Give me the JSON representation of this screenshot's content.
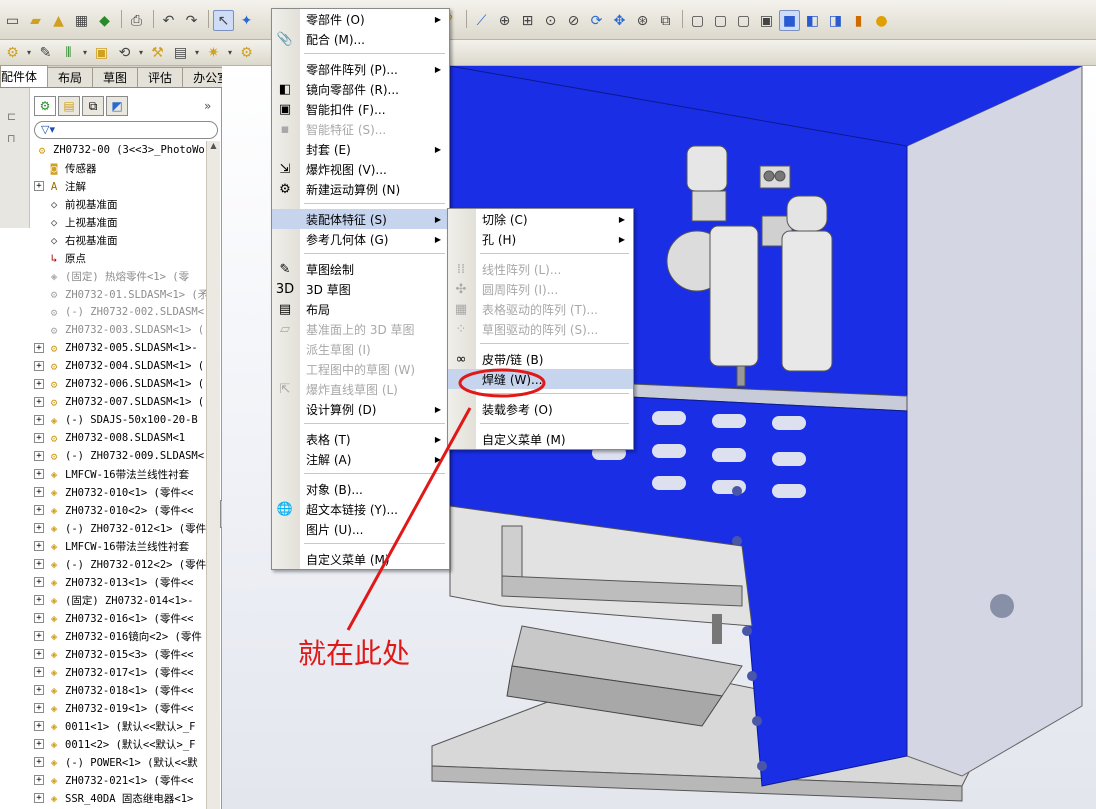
{
  "toolbar": {
    "icons_row1": [
      "new-icon",
      "open-icon",
      "save-icon",
      "print-icon",
      "undo-icon",
      "redo-icon",
      "select-arrow-icon",
      "rebuild-icon",
      "options-icon",
      "help-icon"
    ],
    "icons_view": [
      "zoom-fit-icon",
      "zoom-area-icon",
      "zoom-in-out-icon",
      "zoom-select-icon",
      "rotate-icon",
      "pan-icon",
      "view-orient-icon",
      "display-style-icon",
      "section-icon",
      "wireframe-icon",
      "hidden-line-icon",
      "shaded-icon",
      "shaded-edges-icon",
      "appearance-icon",
      "scene-icon"
    ]
  },
  "tabs": [
    {
      "label": "配件体"
    },
    {
      "label": "布局"
    },
    {
      "label": "草图"
    },
    {
      "label": "评估"
    },
    {
      "label": "办公室产品"
    }
  ],
  "tree": {
    "filter_text": "▽▾",
    "root": "ZH0732-00  (3<<3>_PhotoWo",
    "items": [
      {
        "label": "传感器",
        "expand": "",
        "grey": false,
        "icon": "sensor"
      },
      {
        "label": "注解",
        "expand": "+",
        "grey": false,
        "icon": "annotation"
      },
      {
        "label": "前视基准面",
        "expand": "",
        "grey": false,
        "icon": "plane"
      },
      {
        "label": "上视基准面",
        "expand": "",
        "grey": false,
        "icon": "plane"
      },
      {
        "label": "右视基准面",
        "expand": "",
        "grey": false,
        "icon": "plane"
      },
      {
        "label": "原点",
        "expand": "",
        "grey": false,
        "icon": "origin"
      },
      {
        "label": "(固定) 热熔零件<1> (零",
        "expand": "",
        "grey": true,
        "icon": "part"
      },
      {
        "label": "ZH0732-01.SLDASM<1> (矛",
        "expand": "",
        "grey": true,
        "icon": "asm"
      },
      {
        "label": "(-) ZH0732-002.SLDASM<",
        "expand": "",
        "grey": true,
        "icon": "asm"
      },
      {
        "label": "ZH0732-003.SLDASM<1> (",
        "expand": "",
        "grey": true,
        "icon": "asm"
      },
      {
        "label": "ZH0732-005.SLDASM<1>-",
        "expand": "+",
        "grey": false,
        "icon": "asm"
      },
      {
        "label": "ZH0732-004.SLDASM<1> (",
        "expand": "+",
        "grey": false,
        "icon": "asm"
      },
      {
        "label": "ZH0732-006.SLDASM<1> (",
        "expand": "+",
        "grey": false,
        "icon": "asm"
      },
      {
        "label": "ZH0732-007.SLDASM<1> (",
        "expand": "+",
        "grey": false,
        "icon": "asm"
      },
      {
        "label": "(-) SDAJS-50x100-20-B",
        "expand": "+",
        "grey": false,
        "icon": "part"
      },
      {
        "label": "ZH0732-008.SLDASM<1",
        "expand": "+",
        "grey": false,
        "icon": "asm"
      },
      {
        "label": "(-) ZH0732-009.SLDASM<",
        "expand": "+",
        "grey": false,
        "icon": "asm"
      },
      {
        "label": "LMFCW-16带法兰线性衬套",
        "expand": "+",
        "grey": false,
        "icon": "part"
      },
      {
        "label": "ZH0732-010<1> (零件<<",
        "expand": "+",
        "grey": false,
        "icon": "part"
      },
      {
        "label": "ZH0732-010<2> (零件<<",
        "expand": "+",
        "grey": false,
        "icon": "part"
      },
      {
        "label": "(-) ZH0732-012<1> (零件",
        "expand": "+",
        "grey": false,
        "icon": "part"
      },
      {
        "label": "LMFCW-16带法兰线性衬套",
        "expand": "+",
        "grey": false,
        "icon": "part"
      },
      {
        "label": "(-) ZH0732-012<2> (零件",
        "expand": "+",
        "grey": false,
        "icon": "part"
      },
      {
        "label": "ZH0732-013<1> (零件<<",
        "expand": "+",
        "grey": false,
        "icon": "part"
      },
      {
        "label": "(固定) ZH0732-014<1>-",
        "expand": "+",
        "grey": false,
        "icon": "part"
      },
      {
        "label": "ZH0732-016<1> (零件<<",
        "expand": "+",
        "grey": false,
        "icon": "part"
      },
      {
        "label": "ZH0732-016镜向<2> (零件",
        "expand": "+",
        "grey": false,
        "icon": "part"
      },
      {
        "label": "ZH0732-015<3> (零件<<",
        "expand": "+",
        "grey": false,
        "icon": "part"
      },
      {
        "label": "ZH0732-017<1> (零件<<",
        "expand": "+",
        "grey": false,
        "icon": "part"
      },
      {
        "label": "ZH0732-018<1> (零件<<",
        "expand": "+",
        "grey": false,
        "icon": "part"
      },
      {
        "label": "ZH0732-019<1> (零件<<",
        "expand": "+",
        "grey": false,
        "icon": "part"
      },
      {
        "label": "0011<1> (默认<<默认>_F",
        "expand": "+",
        "grey": false,
        "icon": "part"
      },
      {
        "label": "0011<2> (默认<<默认>_F",
        "expand": "+",
        "grey": false,
        "icon": "part"
      },
      {
        "label": "(-) POWER<1> (默认<<默",
        "expand": "+",
        "grey": false,
        "icon": "part"
      },
      {
        "label": "ZH0732-021<1> (零件<<",
        "expand": "+",
        "grey": false,
        "icon": "part"
      },
      {
        "label": "SSR_40DA 固态继电器<1>",
        "expand": "+",
        "grey": false,
        "icon": "part"
      }
    ]
  },
  "insert_menu": {
    "items": [
      {
        "label": "零部件 (O)",
        "arrow": true,
        "disabled": false,
        "icon": ""
      },
      {
        "label": "配合 (M)...",
        "arrow": false,
        "disabled": false,
        "icon": "📎"
      },
      {
        "sep": true
      },
      {
        "label": "零部件阵列 (P)...",
        "arrow": true,
        "disabled": false,
        "icon": ""
      },
      {
        "label": "镜向零部件 (R)...",
        "arrow": false,
        "disabled": false,
        "icon": "◧"
      },
      {
        "label": "智能扣件 (F)...",
        "arrow": false,
        "disabled": false,
        "icon": "▣"
      },
      {
        "label": "智能特征 (S)...",
        "arrow": false,
        "disabled": true,
        "icon": "▪"
      },
      {
        "label": "封套 (E)",
        "arrow": true,
        "disabled": false,
        "icon": ""
      },
      {
        "label": "爆炸视图 (V)...",
        "arrow": false,
        "disabled": false,
        "icon": "⇲"
      },
      {
        "label": "新建运动算例 (N)",
        "arrow": false,
        "disabled": false,
        "icon": "⚙"
      },
      {
        "sep": true
      },
      {
        "label": "装配体特征 (S)",
        "arrow": true,
        "disabled": false,
        "icon": "",
        "highlight": true
      },
      {
        "label": "参考几何体 (G)",
        "arrow": true,
        "disabled": false,
        "icon": ""
      },
      {
        "sep": true
      },
      {
        "label": "草图绘制",
        "arrow": false,
        "disabled": false,
        "icon": "✎"
      },
      {
        "label": "3D 草图",
        "arrow": false,
        "disabled": false,
        "icon": "3D"
      },
      {
        "label": "布局",
        "arrow": false,
        "disabled": false,
        "icon": "▤"
      },
      {
        "label": "基准面上的 3D 草图",
        "arrow": false,
        "disabled": true,
        "icon": "▱"
      },
      {
        "label": "派生草图 (I)",
        "arrow": false,
        "disabled": true,
        "icon": ""
      },
      {
        "label": "工程图中的草图 (W)",
        "arrow": false,
        "disabled": true,
        "icon": ""
      },
      {
        "label": "爆炸直线草图 (L)",
        "arrow": false,
        "disabled": true,
        "icon": "⇱"
      },
      {
        "label": "设计算例 (D)",
        "arrow": true,
        "disabled": false,
        "icon": ""
      },
      {
        "sep": true
      },
      {
        "label": "表格 (T)",
        "arrow": true,
        "disabled": false,
        "icon": ""
      },
      {
        "label": "注解 (A)",
        "arrow": true,
        "disabled": false,
        "icon": ""
      },
      {
        "sep": true
      },
      {
        "label": "对象 (B)...",
        "arrow": false,
        "disabled": false,
        "icon": ""
      },
      {
        "label": "超文本链接 (Y)...",
        "arrow": false,
        "disabled": false,
        "icon": "🌐"
      },
      {
        "label": "图片 (U)...",
        "arrow": false,
        "disabled": false,
        "icon": ""
      },
      {
        "sep": true
      },
      {
        "label": "自定义菜单 (M)",
        "arrow": false,
        "disabled": false,
        "icon": ""
      }
    ]
  },
  "assembly_features_menu": {
    "items": [
      {
        "label": "切除 (C)",
        "arrow": true,
        "disabled": false,
        "icon": ""
      },
      {
        "label": "孔 (H)",
        "arrow": true,
        "disabled": false,
        "icon": ""
      },
      {
        "sep": true
      },
      {
        "label": "线性阵列 (L)...",
        "arrow": false,
        "disabled": true,
        "icon": "⁞⁞"
      },
      {
        "label": "圆周阵列 (I)...",
        "arrow": false,
        "disabled": true,
        "icon": "✣"
      },
      {
        "label": "表格驱动的阵列 (T)...",
        "arrow": false,
        "disabled": true,
        "icon": "▦"
      },
      {
        "label": "草图驱动的阵列 (S)...",
        "arrow": false,
        "disabled": true,
        "icon": "⁘"
      },
      {
        "sep": true
      },
      {
        "label": "皮带/链 (B)",
        "arrow": false,
        "disabled": false,
        "icon": "∞"
      },
      {
        "label": "焊缝 (W)...",
        "arrow": false,
        "disabled": false,
        "icon": "",
        "highlight": true
      },
      {
        "sep": true
      },
      {
        "label": "装载参考 (O)",
        "arrow": false,
        "disabled": false,
        "icon": ""
      },
      {
        "sep": true
      },
      {
        "label": "自定义菜单 (M)",
        "arrow": false,
        "disabled": false,
        "icon": ""
      }
    ]
  },
  "annotation": {
    "text": "就在此处",
    "color": "#e01818"
  },
  "colors": {
    "machine_blue": "#1a2ee6",
    "menu_highlight": "#c6d4ee"
  }
}
